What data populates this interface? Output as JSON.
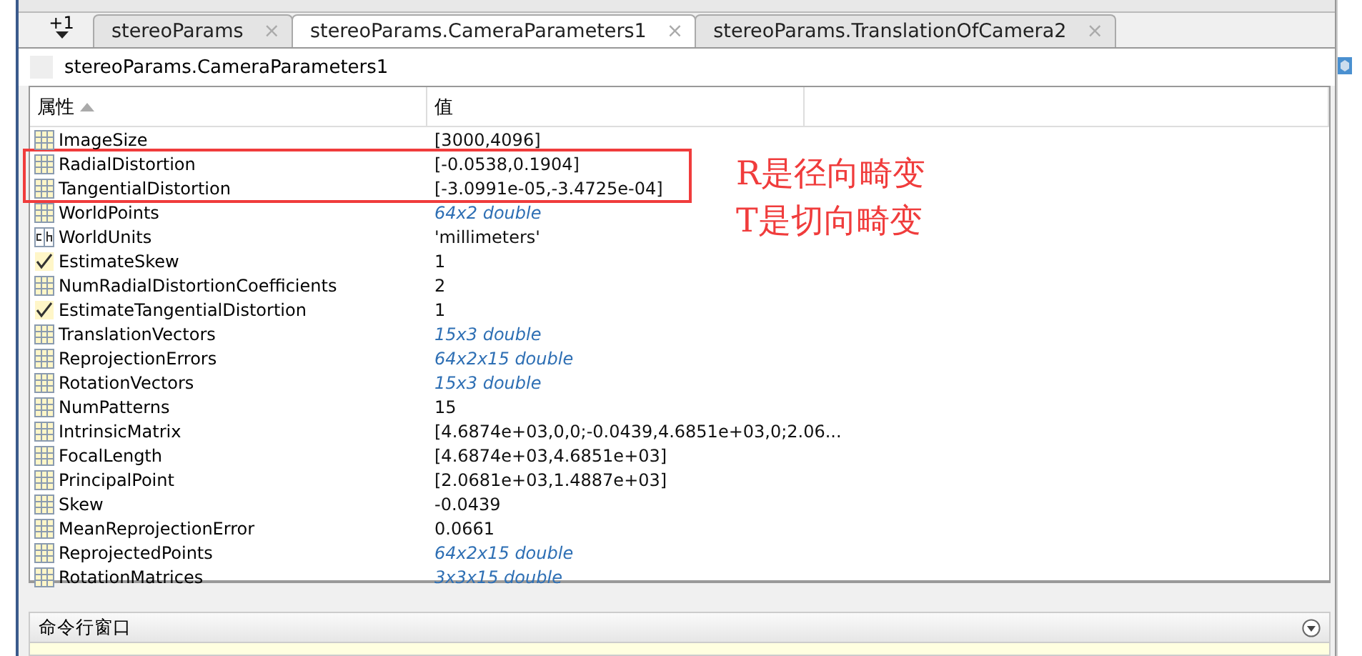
{
  "tabs_overflow": {
    "label": "+1"
  },
  "tabs": [
    {
      "label": "stereoParams",
      "selected": false,
      "close": "×"
    },
    {
      "label": "stereoParams.CameraParameters1",
      "selected": true,
      "close": "×"
    },
    {
      "label": "stereoParams.TranslationOfCamera2",
      "selected": false,
      "close": "×"
    }
  ],
  "breadcrumb": "stereoParams.CameraParameters1",
  "table": {
    "columns": [
      {
        "label": "属性",
        "sorted": true
      },
      {
        "label": "值",
        "sorted": false
      }
    ],
    "rows": [
      {
        "kind": "matrix",
        "name": "ImageSize",
        "value": "[3000,4096]",
        "summary": false,
        "highlighted": false
      },
      {
        "kind": "matrix",
        "name": "RadialDistortion",
        "value": "[-0.0538,0.1904]",
        "summary": false,
        "highlighted": true
      },
      {
        "kind": "matrix",
        "name": "TangentialDistortion",
        "value": "[-3.0991e-05,-3.4725e-04]",
        "summary": false,
        "highlighted": true
      },
      {
        "kind": "matrix",
        "name": "WorldPoints",
        "value": "64x2 double",
        "summary": true,
        "highlighted": false
      },
      {
        "kind": "char",
        "name": "WorldUnits",
        "value": "'millimeters'",
        "summary": false,
        "highlighted": false
      },
      {
        "kind": "logical",
        "name": "EstimateSkew",
        "value": "1",
        "summary": false,
        "highlighted": false
      },
      {
        "kind": "matrix",
        "name": "NumRadialDistortionCoefficients",
        "value": "2",
        "summary": false,
        "highlighted": false
      },
      {
        "kind": "logical",
        "name": "EstimateTangentialDistortion",
        "value": "1",
        "summary": false,
        "highlighted": false
      },
      {
        "kind": "matrix",
        "name": "TranslationVectors",
        "value": "15x3 double",
        "summary": true,
        "highlighted": false
      },
      {
        "kind": "matrix",
        "name": "ReprojectionErrors",
        "value": "64x2x15 double",
        "summary": true,
        "highlighted": false
      },
      {
        "kind": "matrix",
        "name": "RotationVectors",
        "value": "15x3 double",
        "summary": true,
        "highlighted": false
      },
      {
        "kind": "matrix",
        "name": "NumPatterns",
        "value": "15",
        "summary": false,
        "highlighted": false
      },
      {
        "kind": "matrix",
        "name": "IntrinsicMatrix",
        "value": "[4.6874e+03,0,0;-0.0439,4.6851e+03,0;2.06...",
        "summary": false,
        "highlighted": false
      },
      {
        "kind": "matrix",
        "name": "FocalLength",
        "value": "[4.6874e+03,4.6851e+03]",
        "summary": false,
        "highlighted": false
      },
      {
        "kind": "matrix",
        "name": "PrincipalPoint",
        "value": "[2.0681e+03,1.4887e+03]",
        "summary": false,
        "highlighted": false
      },
      {
        "kind": "matrix",
        "name": "Skew",
        "value": "-0.0439",
        "summary": false,
        "highlighted": false
      },
      {
        "kind": "matrix",
        "name": "MeanReprojectionError",
        "value": "0.0661",
        "summary": false,
        "highlighted": false
      },
      {
        "kind": "matrix",
        "name": "ReprojectedPoints",
        "value": "64x2x15 double",
        "summary": true,
        "highlighted": false
      },
      {
        "kind": "matrix",
        "name": "RotationMatrices",
        "value": "3x3x15 double",
        "summary": true,
        "highlighted": false
      }
    ]
  },
  "annotation": {
    "lines": [
      "R是径向畸变",
      "T是切向畸变"
    ]
  },
  "command_window": {
    "title": "命令行窗口"
  }
}
